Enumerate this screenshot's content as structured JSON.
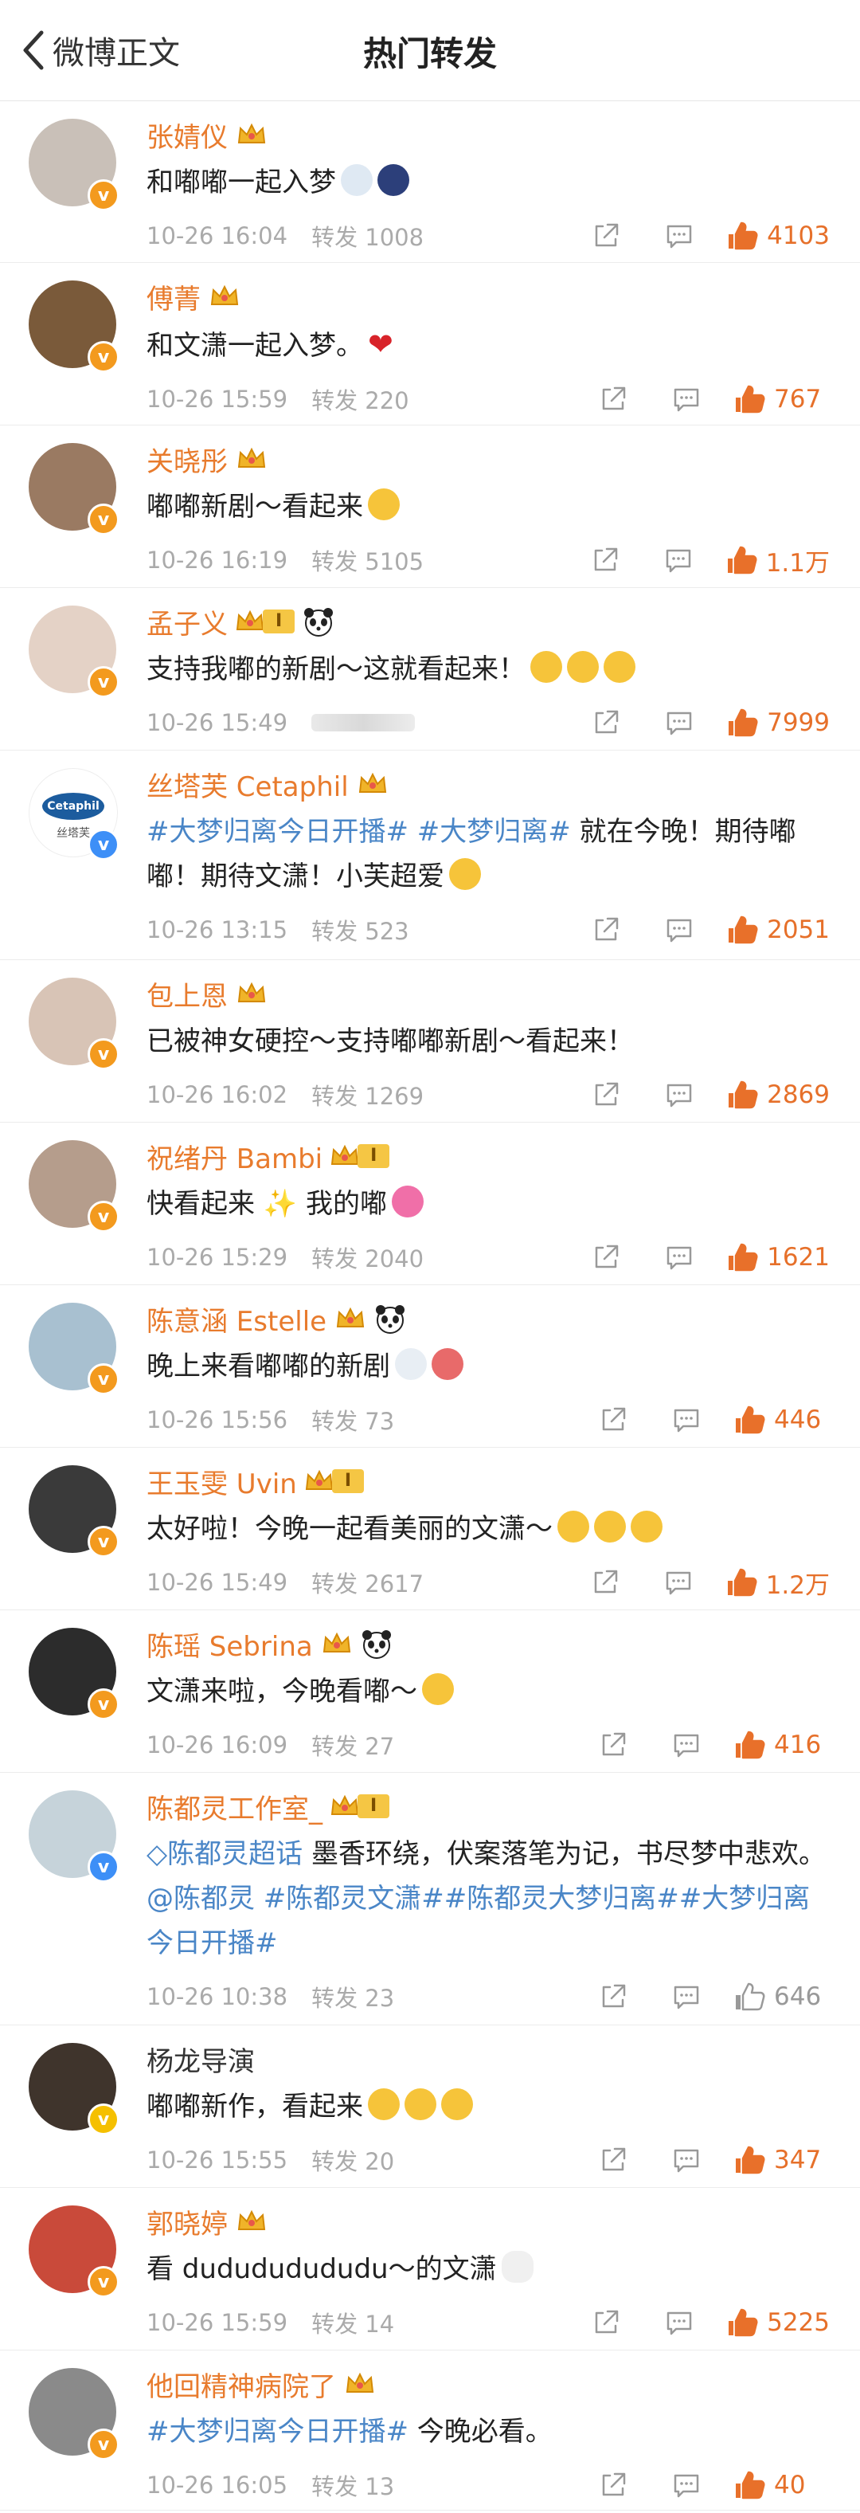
{
  "header": {
    "back_label": "微博正文",
    "title": "热门转发"
  },
  "items": [
    {
      "name": "张婧仪",
      "orange": true,
      "crown": true,
      "text": "和嘟嘟一起入梦",
      "time": "10-26 16:04",
      "repost": "转发 1008",
      "likes": "4103",
      "badge": "orange",
      "avatar_color": "#c9c0b8"
    },
    {
      "name": "傅菁",
      "orange": true,
      "crown": true,
      "text": "和文潇一起入梦。",
      "time": "10-26 15:59",
      "repost": "转发 220",
      "likes": "767",
      "badge": "orange",
      "avatar_color": "#7a5a3a"
    },
    {
      "name": "关晓彤",
      "orange": true,
      "crown": true,
      "text": "嘟嘟新剧～看起来",
      "time": "10-26 16:19",
      "repost": "转发 5105",
      "likes": "1.1万",
      "badge": "orange",
      "avatar_color": "#9a7a62"
    },
    {
      "name": "孟子义",
      "orange": true,
      "level": "I",
      "panda": true,
      "text": "支持我嘟的新剧～这就看起来！",
      "time": "10-26 15:49",
      "repost": "",
      "likes": "7999",
      "badge": "orange",
      "avatar_color": "#e4d2c6"
    },
    {
      "name": "丝塔芙 Cetaphil",
      "orange": true,
      "crown": true,
      "topic1": "#大梦归离今日开播#",
      "topic2": "#大梦归离#",
      "text": " 就在今晚！期待嘟嘟！期待文潇！小芙超爱",
      "time": "10-26 13:15",
      "repost": "转发 523",
      "likes": "2051",
      "badge": "blue",
      "avatar_color": "#ffffff",
      "logo_text": "Cetaphil",
      "logo_sub": "丝塔芙"
    },
    {
      "name": "包上恩",
      "orange": true,
      "crown": true,
      "text": "已被神女硬控～支持嘟嘟新剧～看起来！",
      "time": "10-26 16:02",
      "repost": "转发 1269",
      "likes": "2869",
      "badge": "orange",
      "avatar_color": "#d8c4b6"
    },
    {
      "name": "祝绪丹 Bambi",
      "orange": true,
      "level": "I",
      "text": "快看起来 ✨ 我的嘟",
      "time": "10-26 15:29",
      "repost": "转发 2040",
      "likes": "1621",
      "badge": "orange",
      "avatar_color": "#b59d8c"
    },
    {
      "name": "陈意涵 Estelle",
      "orange": true,
      "crown": true,
      "panda": true,
      "text": "晚上来看嘟嘟的新剧",
      "time": "10-26 15:56",
      "repost": "转发 73",
      "likes": "446",
      "badge": "orange",
      "avatar_color": "#a8c0d0"
    },
    {
      "name": "王玉雯 Uvin",
      "orange": true,
      "level": "I",
      "text": "太好啦！今晚一起看美丽的文潇～",
      "time": "10-26 15:49",
      "repost": "转发 2617",
      "likes": "1.2万",
      "badge": "orange",
      "avatar_color": "#3a3a3a"
    },
    {
      "name": "陈瑶 Sebrina",
      "orange": true,
      "crown": true,
      "panda": true,
      "text": "文潇来啦，今晚看嘟～",
      "time": "10-26 16:09",
      "repost": "转发 27",
      "likes": "416",
      "badge": "orange",
      "avatar_color": "#2c2c2c"
    },
    {
      "name": "陈都灵工作室_",
      "orange": true,
      "level": "I",
      "super_topic": "陈都灵超话",
      "text": " 墨香环绕，伏案落笔为记，书尽梦中悲欢。",
      "mention": "@陈都灵",
      "topic_tail": " #陈都灵文潇##陈都灵大梦归离##大梦归离今日开播#",
      "time": "10-26 10:38",
      "repost": "转发 23",
      "likes": "646",
      "likes_gray": true,
      "badge": "blue",
      "avatar_color": "#c6d3da"
    },
    {
      "name": "杨龙导演",
      "orange": false,
      "text": "嘟嘟新作，看起来",
      "time": "10-26 15:55",
      "repost": "转发 20",
      "likes": "347",
      "badge": "yellow",
      "avatar_color": "#3f342c"
    },
    {
      "name": "郭晓婷",
      "orange": true,
      "crown": true,
      "text": "看 dudududududu～的文潇",
      "time": "10-26 15:59",
      "repost": "转发 14",
      "likes": "5225",
      "badge": "orange",
      "avatar_color": "#c94a3a"
    },
    {
      "name": "他回精神病院了",
      "orange": true,
      "crown": true,
      "topic1": "#大梦归离今日开播#",
      "text": " 今晚必看。",
      "time": "10-26 16:05",
      "repost": "转发 13",
      "likes": "40",
      "badge": "orange",
      "avatar_color": "#8a8a8a"
    }
  ]
}
